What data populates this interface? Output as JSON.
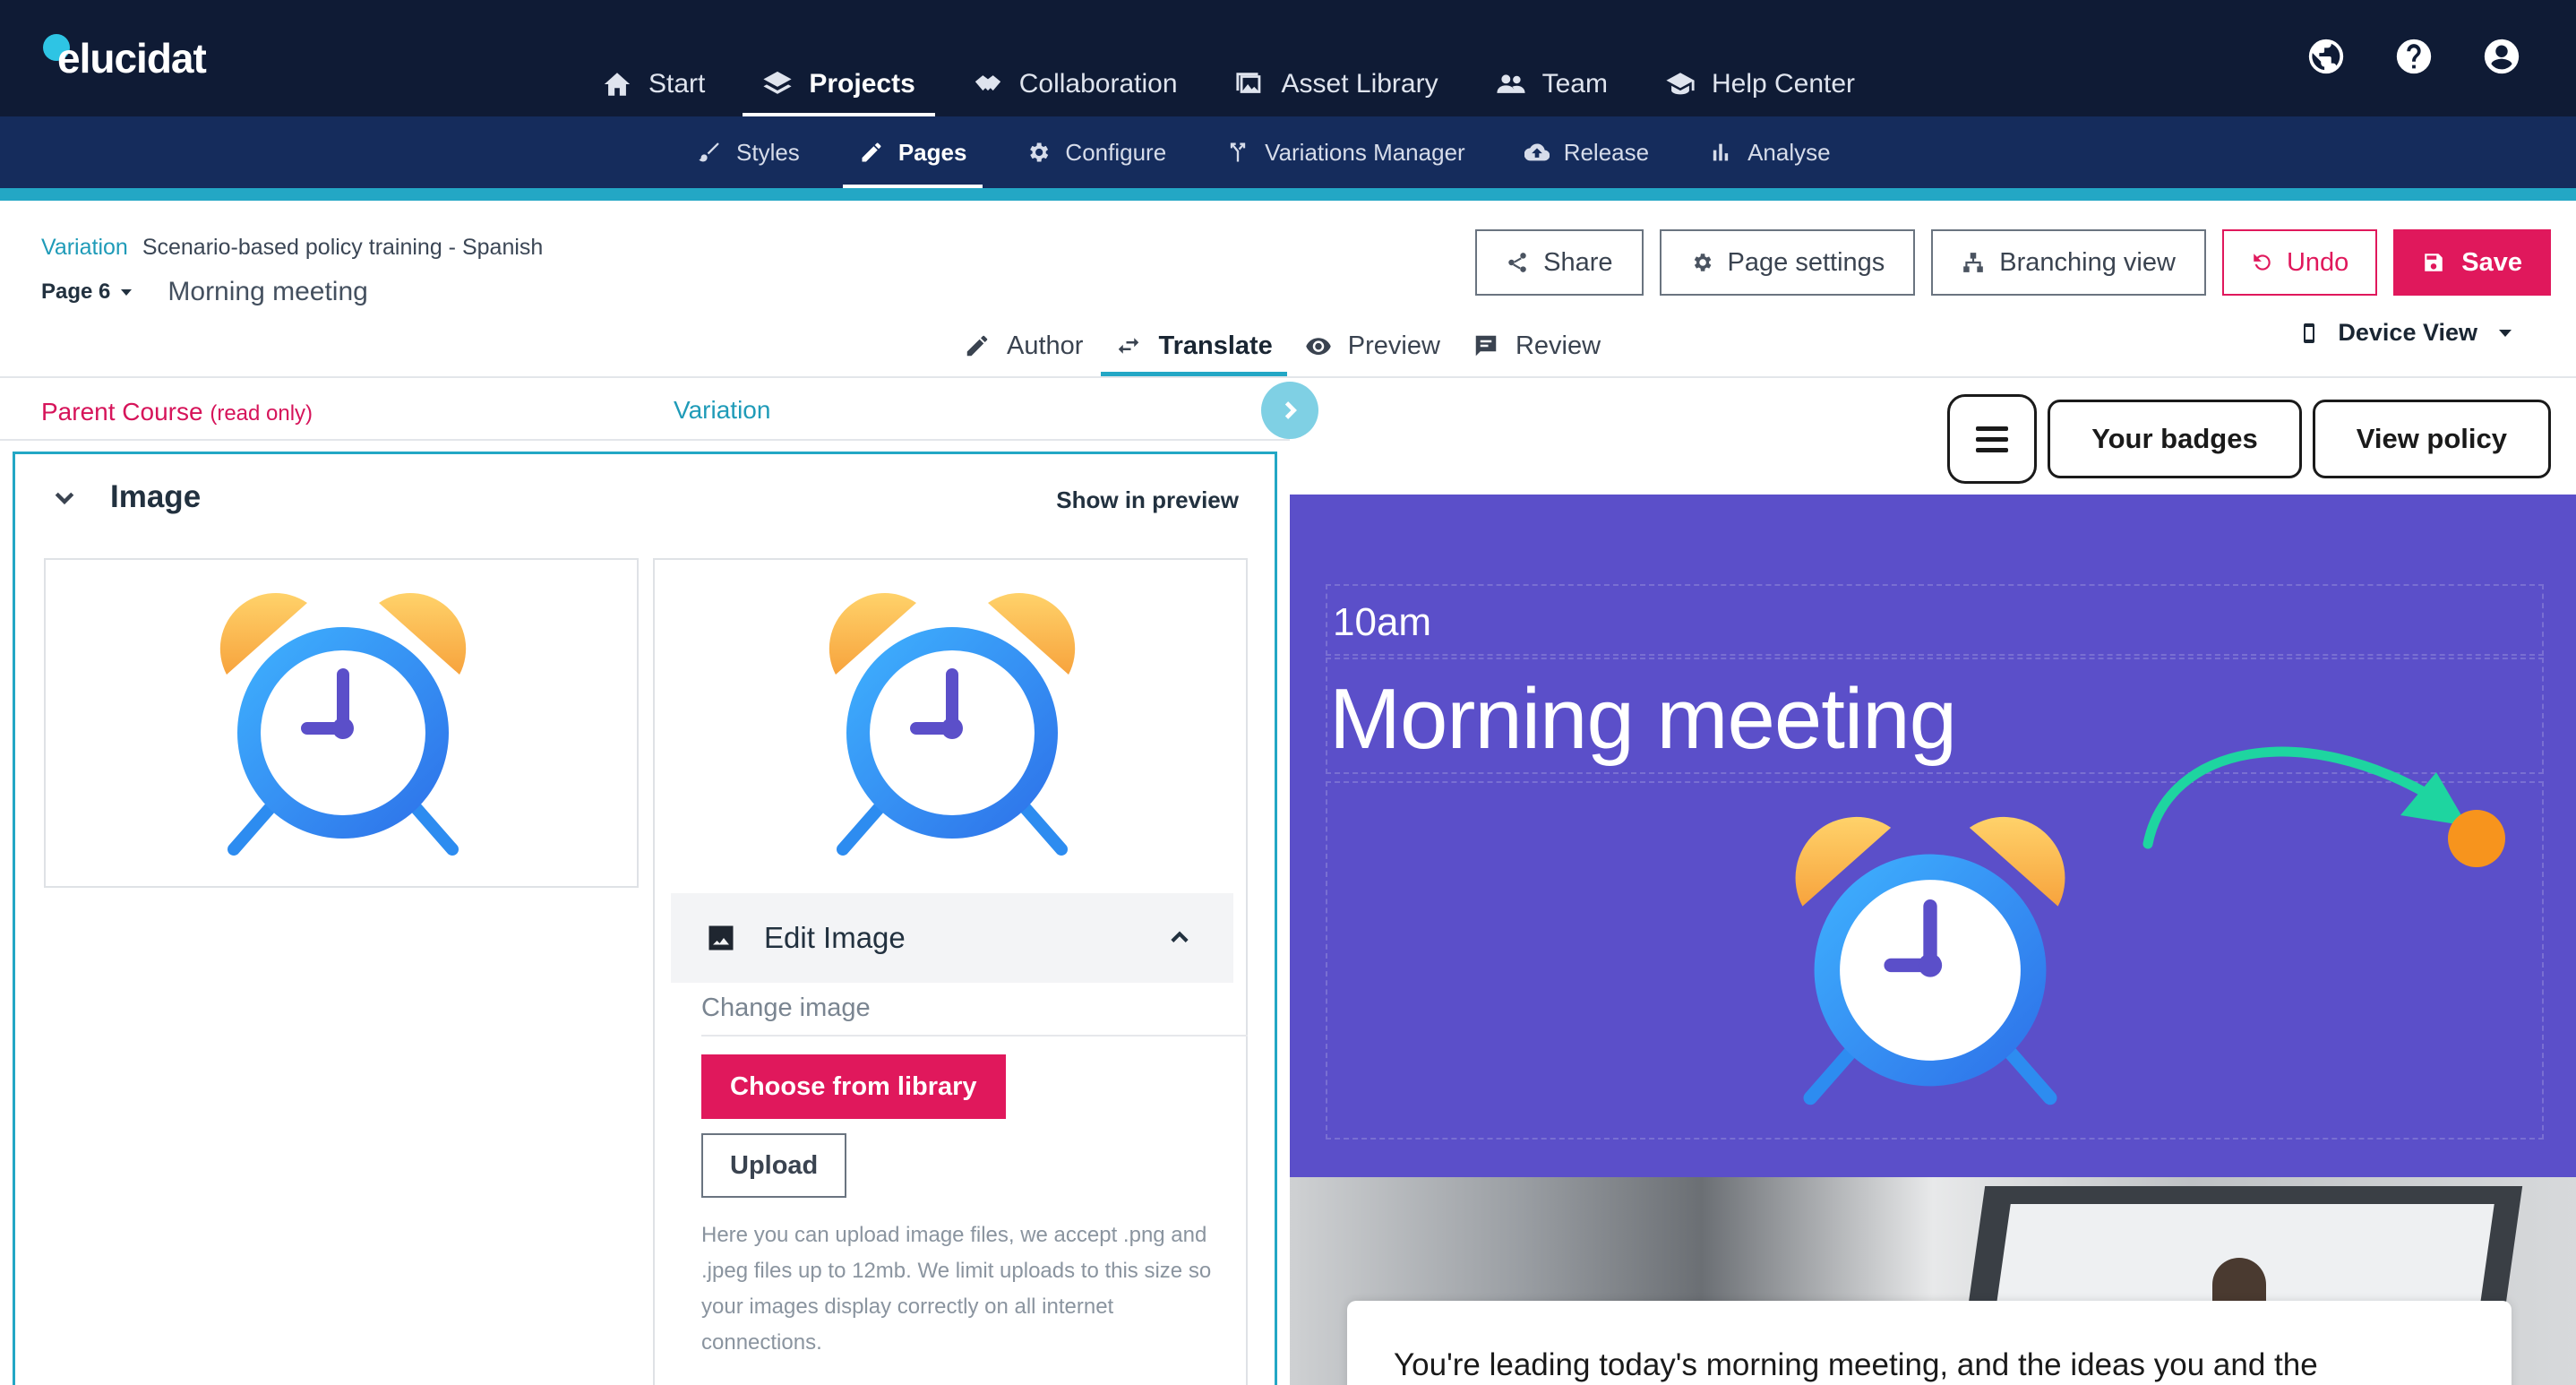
{
  "brand": {
    "name": "elucidat"
  },
  "main_nav": [
    {
      "label": "Start",
      "icon": "home-icon"
    },
    {
      "label": "Projects",
      "icon": "layers-icon"
    },
    {
      "label": "Collaboration",
      "icon": "handshake-icon"
    },
    {
      "label": "Asset Library",
      "icon": "images-icon"
    },
    {
      "label": "Team",
      "icon": "team-icon"
    },
    {
      "label": "Help Center",
      "icon": "graduation-cap-icon"
    }
  ],
  "sub_nav": [
    {
      "label": "Styles",
      "icon": "brush-icon"
    },
    {
      "label": "Pages",
      "icon": "pencil-icon"
    },
    {
      "label": "Configure",
      "icon": "gear-icon"
    },
    {
      "label": "Variations Manager",
      "icon": "fork-icon"
    },
    {
      "label": "Release",
      "icon": "cloud-upload-icon"
    },
    {
      "label": "Analyse",
      "icon": "bar-chart-icon"
    }
  ],
  "header": {
    "variation_label": "Variation",
    "variation_name": "Scenario-based policy training - Spanish",
    "page_number": "Page 6",
    "page_title": "Morning meeting"
  },
  "actions": {
    "share": "Share",
    "page_settings": "Page settings",
    "branching_view": "Branching view",
    "undo": "Undo",
    "save": "Save"
  },
  "modes": [
    "Author",
    "Translate",
    "Preview",
    "Review"
  ],
  "device_view": "Device View",
  "columns": {
    "parent_course": "Parent Course",
    "read_only": "(read only)",
    "variation": "Variation"
  },
  "image_panel": {
    "title": "Image",
    "show_in_preview": "Show in preview",
    "edit_image": "Edit Image",
    "change_image": "Change image",
    "choose_from_library": "Choose from library",
    "upload": "Upload",
    "help_text": "Here you can upload image files, we accept .png and .jpeg files up to 12mb. We limit uploads to this size so your images display correctly on all internet connections."
  },
  "preview": {
    "your_badges": "Your badges",
    "view_policy": "View policy",
    "time": "10am",
    "headline": "Morning meeting",
    "body_text": "You're leading today's morning meeting, and the ideas you and the"
  },
  "colors": {
    "nav_bg": "#0f1b35",
    "subnav_bg": "#152c5c",
    "accent": "#23a7c5",
    "primary": "#e0185c",
    "hero_bg": "#5b4fc9",
    "arrow": "#1ed5a0",
    "dot": "#f7941d"
  }
}
